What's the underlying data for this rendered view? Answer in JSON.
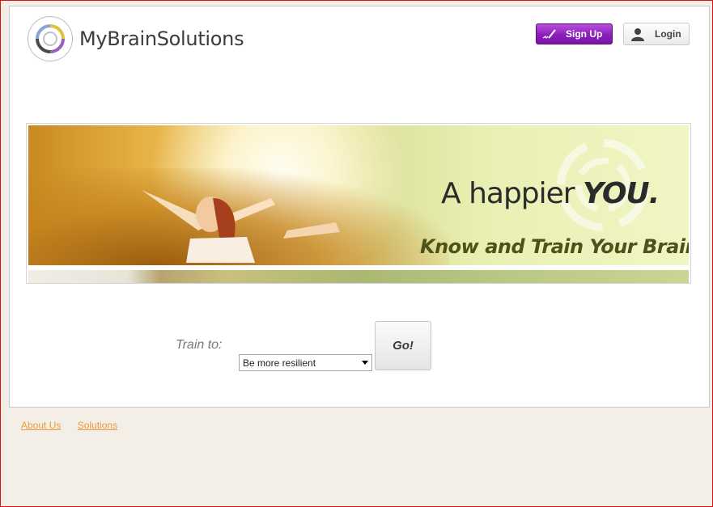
{
  "header": {
    "logo_text": "MyBrainSolutions",
    "signup_label": "Sign Up",
    "login_label": "Login"
  },
  "banner": {
    "headline_part1": "A happier ",
    "headline_part2": "YOU.",
    "tagline": "Know and Train Your Brain"
  },
  "train": {
    "label": "Train to:",
    "selected_option": "Be more resilient",
    "go_label": "Go!"
  },
  "footer": {
    "links": [
      "About Us",
      "Solutions"
    ]
  },
  "colors": {
    "brand_purple": "#8a1fb8",
    "link_orange": "#e89a3c",
    "page_background": "#f4efe6",
    "frame_red": "#e01010"
  },
  "icons": [
    "brain-logo-icon",
    "signup-pen-icon",
    "user-silhouette-icon",
    "swirl-watermark-icon",
    "dropdown-arrow-icon"
  ]
}
